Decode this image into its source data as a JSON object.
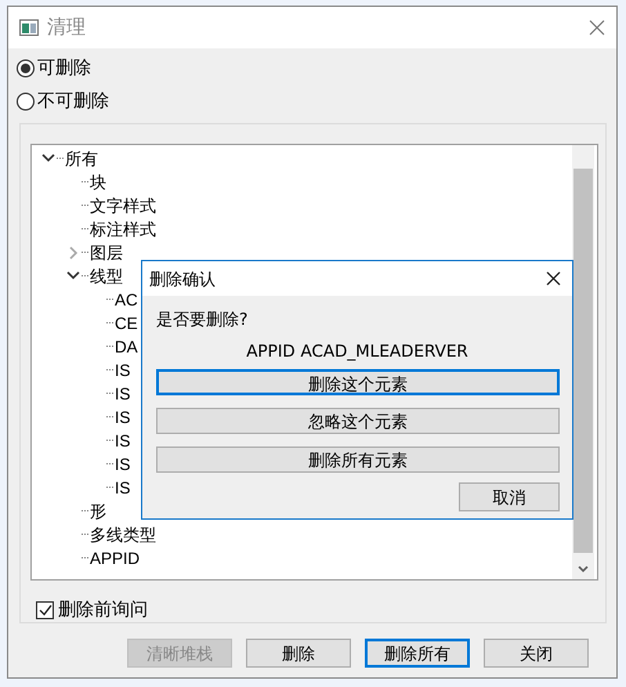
{
  "window": {
    "title": "清理"
  },
  "radios": [
    {
      "label": "可删除",
      "selected": true
    },
    {
      "label": "不可删除",
      "selected": false
    }
  ],
  "tree": [
    {
      "label": "所有",
      "expanded": true,
      "children": [
        {
          "label": "块"
        },
        {
          "label": "文字样式"
        },
        {
          "label": "标注样式"
        },
        {
          "label": "图层",
          "expanded": false
        },
        {
          "label": "线型",
          "expanded": true,
          "children": [
            {
              "label": "AC"
            },
            {
              "label": "CE"
            },
            {
              "label": "DA"
            },
            {
              "label": "IS"
            },
            {
              "label": "IS"
            },
            {
              "label": "IS"
            },
            {
              "label": "IS"
            },
            {
              "label": "IS"
            },
            {
              "label": "IS"
            }
          ]
        },
        {
          "label": "形"
        },
        {
          "label": "多线类型"
        },
        {
          "label": "APPID"
        }
      ]
    }
  ],
  "confirm_checkbox": {
    "label": "删除前询问",
    "checked": true
  },
  "buttons": [
    {
      "label": "清晰堆栈",
      "disabled": true,
      "focused": false
    },
    {
      "label": "删除",
      "disabled": false,
      "focused": false
    },
    {
      "label": "删除所有",
      "disabled": false,
      "focused": true
    },
    {
      "label": "关闭",
      "disabled": false,
      "focused": false
    }
  ],
  "dialog": {
    "title": "删除确认",
    "question": "是否要删除?",
    "item": "APPID ACAD_MLEADERVER",
    "buttons": [
      {
        "label": "删除这个元素",
        "focused": true
      },
      {
        "label": "忽略这个元素",
        "focused": false
      },
      {
        "label": "删除所有元素",
        "focused": false
      }
    ],
    "cancel": "取消"
  }
}
